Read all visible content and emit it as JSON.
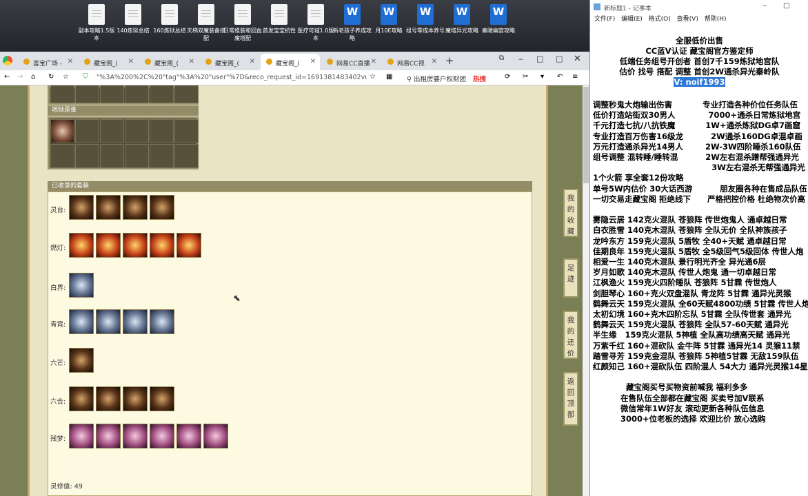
{
  "desktop": {
    "icons": [
      {
        "label": "副本攻略1.5版本",
        "kind": "txt"
      },
      {
        "label": "140炼狱总结",
        "kind": "txt"
      },
      {
        "label": "160炼狱总结",
        "kind": "txt"
      },
      {
        "label": "天梯双魔装备搭配",
        "kind": "txt"
      },
      {
        "label": "日常维装和回血魔塔配",
        "kind": "txt"
      },
      {
        "label": "首发宝宝抗性",
        "kind": "txt"
      },
      {
        "label": "医疗可城1.0版本",
        "kind": "txt"
      },
      {
        "label": "新老孩子养成攻略",
        "kind": "word"
      },
      {
        "label": "月10E攻略",
        "kind": "word"
      },
      {
        "label": "组号零成本养号",
        "kind": "word"
      },
      {
        "label": "魔塔异光攻略",
        "kind": "word"
      },
      {
        "label": "秦陵幽宫攻略",
        "kind": "word"
      }
    ]
  },
  "browser": {
    "tabs": [
      {
        "label": "鉴宝广场 -",
        "active": false
      },
      {
        "label": "藏宝阁_(",
        "active": false
      },
      {
        "label": "藏宝阁_(",
        "active": false
      },
      {
        "label": "藏宝阁_(",
        "active": false
      },
      {
        "label": "藏宝阁_(",
        "active": true
      },
      {
        "label": "网易CC直播",
        "active": false
      },
      {
        "label": "网易CC视",
        "active": false
      }
    ],
    "new_tab": "+",
    "url": "\"%3A%200%2C%20\"tag\"%3A%20\"user\"%7D&reco_request_id=1691381483402vuffk",
    "search_text": "出租房要户权财团",
    "hot_label": "热搜"
  },
  "game": {
    "storage_title": "地狱是谁",
    "suit_title": "已收录的套装",
    "rows": [
      {
        "label": "灵台:",
        "count": 4,
        "style": "d"
      },
      {
        "label": "燃灯:",
        "count": 5,
        "style": "r"
      },
      {
        "label": "白界:",
        "count": 1,
        "style": "b"
      },
      {
        "label": "青霓:",
        "count": 4,
        "style": "b"
      },
      {
        "label": "六芒:",
        "count": 1,
        "style": "d"
      },
      {
        "label": "六合:",
        "count": 4,
        "style": "d"
      },
      {
        "label": "残梦:",
        "count": 6,
        "style": "p"
      }
    ],
    "spirit_value": "灵修值: 49",
    "side_buttons": [
      "我的收藏",
      "足迹",
      "我的还价",
      "返回顶部"
    ]
  },
  "notepad": {
    "title": "新标题1 - 记事本",
    "menu": [
      "文件(F)",
      "编辑(E)",
      "格式(O)",
      "查看(V)",
      "帮助(H)"
    ],
    "header_lines": [
      "全服低价出售",
      "CC蓝V认证  藏宝阁官方鉴定师",
      "低端任务组号开创者        首创7千159炼狱地宫队",
      "估价 找号 搭配 调整        首创2W通杀异光秦岭队"
    ],
    "contact": "V: noif1993",
    "body": "调整秒鬼大炮输出伤害           专业打造各种价位任务队伍\n低价打造站街双30男人            7000+通杀日常炼狱地宫\n千元打造七抗/八抗铁魔           1W+通杀炼狱DG卓7画窟\n专业打造百万伤害16级龙          2W通杀160DG卓混卓画\n万元打造通杀异光14男人        2W-3W四阶睡杀160队伍\n组号调整 混转睡/睡转混          2W左右混杀蹭帮强通异光\n                                           3W左右混杀无帮强通异光\n1个火箭 享全套12份攻略\n单号5W内估价 30大话西游          朋友圈各种在售成品队伍\n一切交易走藏宝阁 拒绝线下      严格把控价格 杜绝物次价高\n\n雾隐云居 142克火混队 苍狼阵 传世炮鬼人 通卓越日常\n白衣胜雪 140克木混队 苍狼阵 全队无价 全队神族孩子\n龙吟东方 159克火混队 5盾牧 全40+天赋 通卓越日常\n佳期良年 159克火混队 5盾牧 全5级回气5级回体 传世人炮\n相爱一生 140克木混队 景行明光齐全 异光通6层\n岁月如歌 140克木混队 传世人炮鬼 通一切卓越日常\n江枫渔火 159克火四阶睡队 苍狼阵 5甘霖 传世炮人\n剑胆琴心 160+克火双盘混队 青龙阵 5甘霖 通异光灵猴\n鹤舞云天 159克火混队 全60天赋4800功绩 5甘霖 传世人炮\n太初幻境 160+克木四阶忘队 5甘霖 全队传世套 通异光\n鹤舞云天 159克火混队 苍狼阵 全队57-60天赋 通异光\n半生缘   159克火混队 5神植 全队高功绩高天赋 通异光\n万紫千红 160+混砍队 金牛阵 5甘霖 通异光14 灵猴11禁\n踏雪寻芳 159克金混队 苍狼阵 5神植5甘霖 无敌159队伍\n红颜知己 160+混砍队伍 四阶混人 54大力 通异光灵猴14星\n\n            藏宝阁买号买物资前喊我 福利多多\n          在售队伍全部都在藏宝阁 买卖号加V联系\n          微信常年1W好友 滚动更新各种队伍信息\n          3000+位老板的选择 欢迎比价 放心选购"
  },
  "colors": {
    "accent": "#2f78d6",
    "panel": "#fdfae2",
    "header": "#948b67"
  }
}
